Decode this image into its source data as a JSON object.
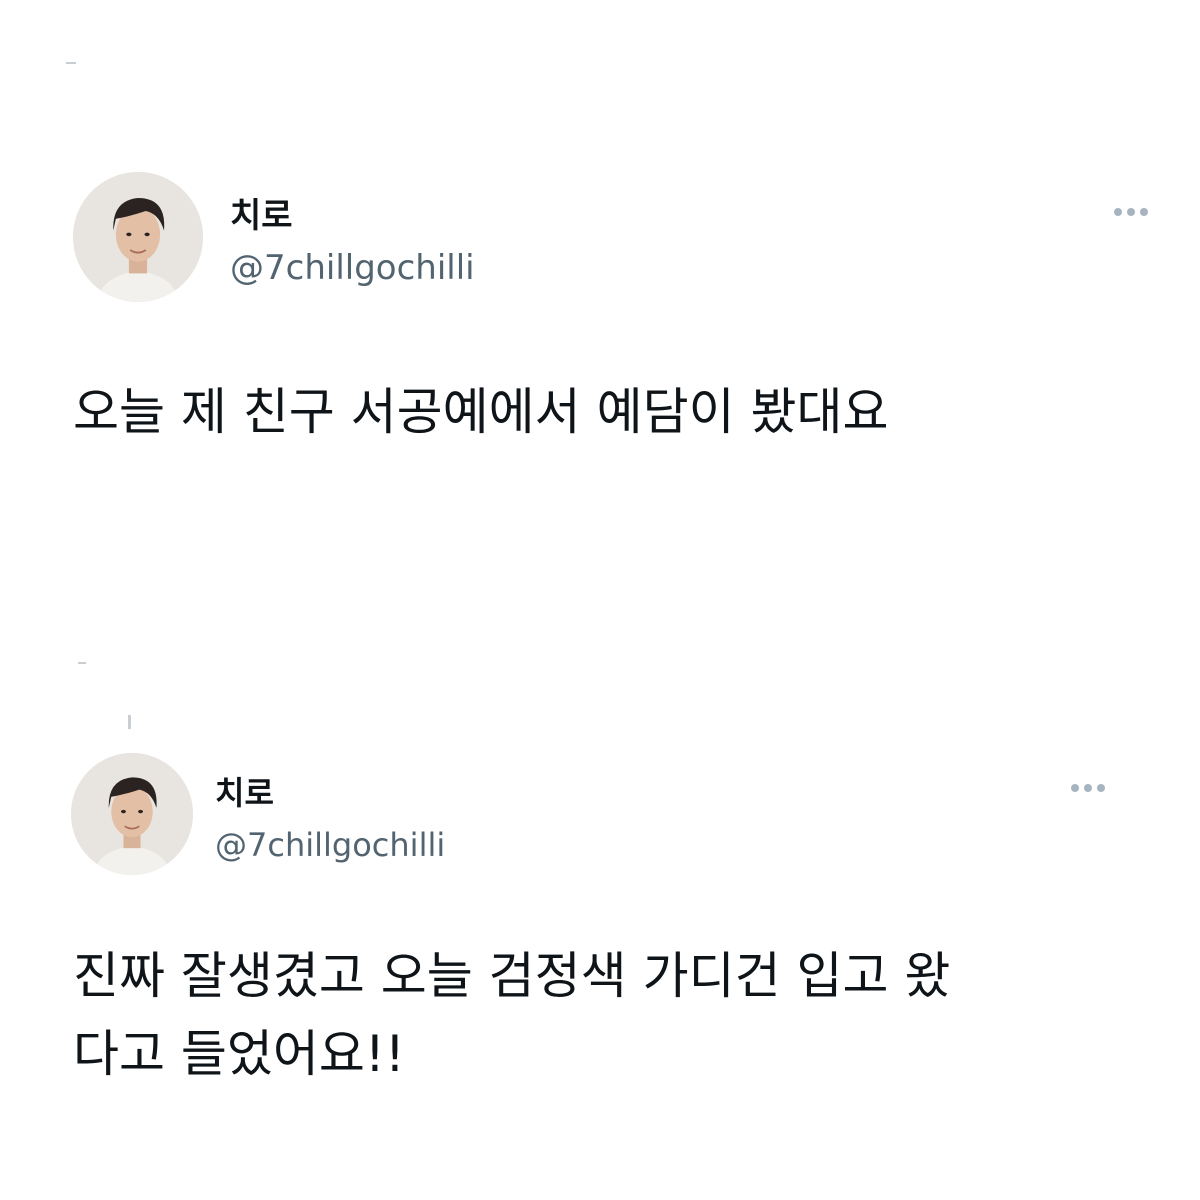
{
  "tweets": [
    {
      "display_name": "치로",
      "handle": "@7chillgochilli",
      "text": "오늘 제 친구 서공예에서 예담이 봤대요",
      "avatar_icon": "profile-photo",
      "more_icon": "more-options-icon"
    },
    {
      "display_name": "치로",
      "handle": "@7chillgochilli",
      "text": "진짜 잘생겼고 오늘 검정색 가디건 입고 왔\n다고 들었어요!!",
      "avatar_icon": "profile-photo",
      "more_icon": "more-options-icon"
    }
  ],
  "colors": {
    "text": "#0f1419",
    "handle": "#536471",
    "more_dots": "#a7b4bf",
    "background": "#ffffff"
  }
}
